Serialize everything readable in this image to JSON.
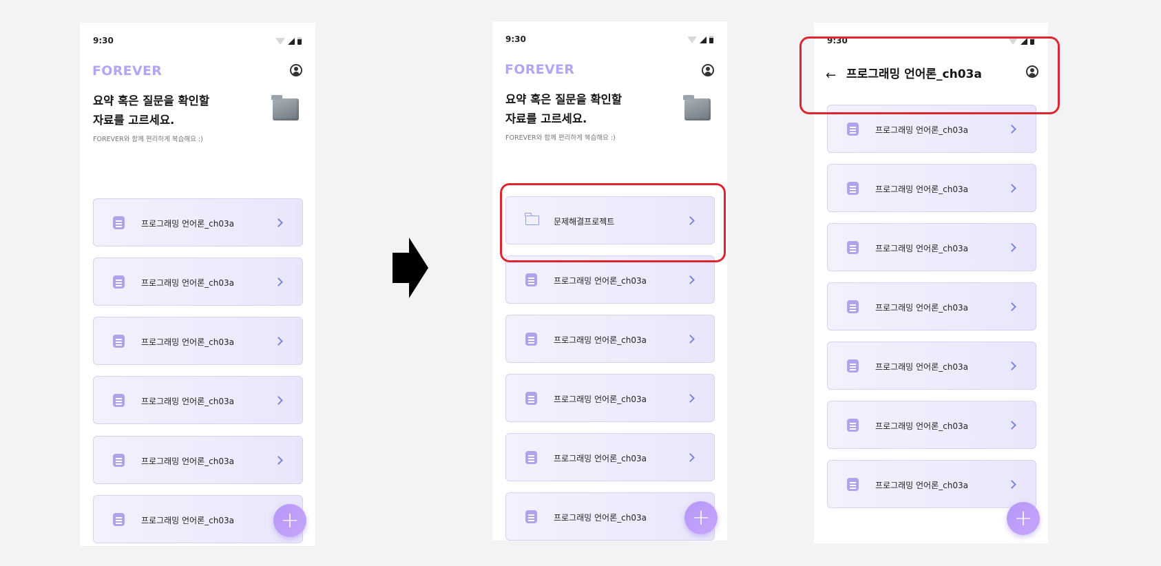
{
  "status_bar": {
    "time": "9:30"
  },
  "app": {
    "brand": "FOREVER"
  },
  "home": {
    "headline_line1": "요약 혹은 질문을 확인할",
    "headline_line2": "자료를 고르세요.",
    "subtext": "FOREVER와 함께 편리하게 복습해요 :)"
  },
  "screen1": {
    "items": [
      {
        "label": "프로그래밍 언어론_ch03a"
      },
      {
        "label": "프로그래밍 언어론_ch03a"
      },
      {
        "label": "프로그래밍 언어론_ch03a"
      },
      {
        "label": "프로그래밍 언어론_ch03a"
      },
      {
        "label": "프로그래밍 언어론_ch03a"
      },
      {
        "label": "프로그래밍 언어론_ch03a"
      }
    ]
  },
  "screen2": {
    "folder": {
      "label": "문제해결프로젝트"
    },
    "items": [
      {
        "label": "프로그래밍 언어론_ch03a"
      },
      {
        "label": "프로그래밍 언어론_ch03a"
      },
      {
        "label": "프로그래밍 언어론_ch03a"
      },
      {
        "label": "프로그래밍 언어론_ch03a"
      },
      {
        "label": "프로그래밍 언어론_ch03a"
      }
    ]
  },
  "screen3": {
    "title": "프로그래밍 언어론_ch03a",
    "items": [
      {
        "label": "프로그래밍 언어론_ch03a"
      },
      {
        "label": "프로그래밍 언어론_ch03a"
      },
      {
        "label": "프로그래밍 언어론_ch03a"
      },
      {
        "label": "프로그래밍 언어론_ch03a"
      },
      {
        "label": "프로그래밍 언어론_ch03a"
      },
      {
        "label": "프로그래밍 언어론_ch03a"
      },
      {
        "label": "프로그래밍 언어론_ch03a"
      }
    ]
  },
  "fab": {
    "label": "+"
  },
  "icons": {
    "profile": "profile-icon",
    "document": "document-icon",
    "folder": "folder-icon",
    "chevron": "chevron-right-icon",
    "back": "back-arrow-icon",
    "transition": "right-arrow-icon"
  },
  "colors": {
    "brand": "#b3a5f5",
    "highlight": "#e0242e",
    "card_border": "#d6d2f6",
    "fab": "#c0a0fa"
  }
}
